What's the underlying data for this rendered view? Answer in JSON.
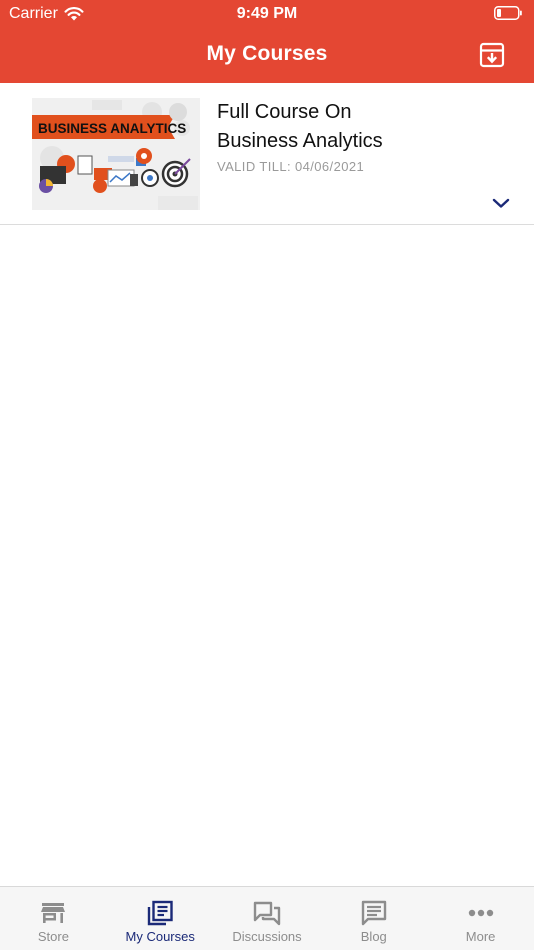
{
  "status_bar": {
    "carrier": "Carrier",
    "time": "9:49 PM"
  },
  "nav": {
    "title": "My Courses",
    "archive_icon": "archive-download-icon"
  },
  "courses": [
    {
      "title_line1": "Full Course On",
      "title_line2": "Business Analytics",
      "valid_till": "VALID TILL: 04/06/2021",
      "thumbnail_text": "BUSINESS ANALYTICS",
      "expand_icon": "chevron-down-icon"
    }
  ],
  "tabs": [
    {
      "label": "Store",
      "icon": "store-icon",
      "active": false
    },
    {
      "label": "My Courses",
      "icon": "courses-icon",
      "active": true
    },
    {
      "label": "Discussions",
      "icon": "discussions-icon",
      "active": false
    },
    {
      "label": "Blog",
      "icon": "blog-icon",
      "active": false
    },
    {
      "label": "More",
      "icon": "more-icon",
      "active": false
    }
  ],
  "colors": {
    "header": "#e44733",
    "active_tab": "#1b2a78",
    "inactive_tab": "#8d8d8d"
  }
}
